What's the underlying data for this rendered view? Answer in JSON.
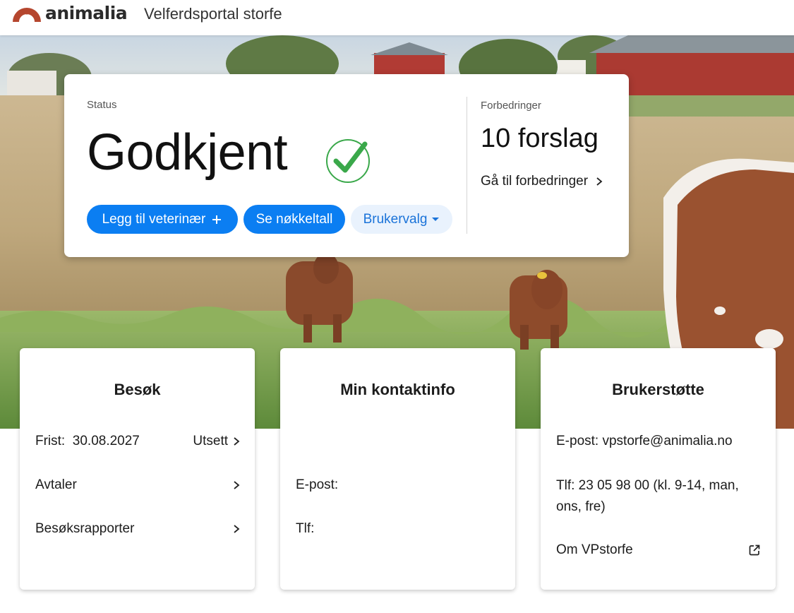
{
  "header": {
    "brand": "animalia",
    "app_title": "Velferdsportal storfe"
  },
  "status": {
    "label": "Status",
    "value": "Godkjent",
    "icon": "check-circle-icon",
    "buttons": {
      "add_vet": "Legg til veterinær",
      "key_figures": "Se nøkkeltall",
      "user_options": "Brukervalg"
    }
  },
  "improvements": {
    "label": "Forbedringer",
    "value": "10 forslag",
    "link": "Gå til forbedringer"
  },
  "cards": {
    "visits": {
      "title": "Besøk",
      "deadline_label": "Frist:",
      "deadline_date": "30.08.2027",
      "postpone": "Utsett",
      "appointments": "Avtaler",
      "reports": "Besøksrapporter"
    },
    "contact": {
      "title": "Min kontaktinfo",
      "email_label": "E-post:",
      "phone_label": "Tlf:"
    },
    "support": {
      "title": "Brukerstøtte",
      "email": "E-post: vpstorfe@animalia.no",
      "phone": "Tlf: 23 05 98 00 (kl. 9-14, man, ons, fre)",
      "about": "Om VPstorfe"
    }
  },
  "colors": {
    "primary": "#0b7ef2",
    "secondary_bg": "#e9f2fd",
    "success": "#3aa84a",
    "brand_mark": "#b5462e"
  }
}
